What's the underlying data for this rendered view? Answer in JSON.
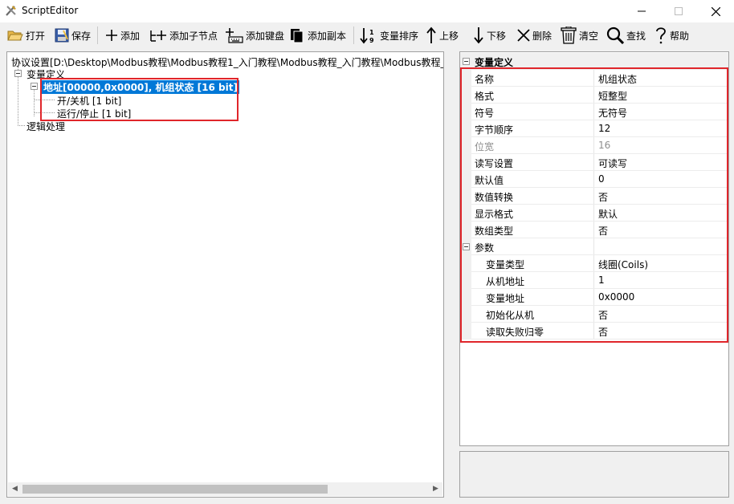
{
  "window": {
    "title": "ScriptEditor",
    "icon": "script-editor-app-icon",
    "controls": [
      "minimize-icon",
      "maximize-icon",
      "close-icon"
    ]
  },
  "toolbar": {
    "open": "打开",
    "save": "保存",
    "add": "添加",
    "add_child": "添加子节点",
    "add_key": "添加键盘",
    "add_copy": "添加副本",
    "sort_vars": "变量排序",
    "move_up": "上移",
    "move_down": "下移",
    "delete": "删除",
    "clear": "清空",
    "find": "查找",
    "help": "帮助"
  },
  "tree": {
    "root": "协议设置[D:\\Desktop\\Modbus教程\\Modbus教程1_入门教程\\Modbus教程_入门教程\\Modbus教程_入",
    "var_def": "变量定义",
    "selected_node": "地址[00000,0x0000], 机组状态 [16 bit]",
    "child1": "开/关机 [1 bit]",
    "child2": "运行/停止 [1 bit]",
    "logic": "逻辑处理"
  },
  "props": {
    "category": "变量定义",
    "rows": [
      {
        "name": "名称",
        "value": "机组状态"
      },
      {
        "name": "格式",
        "value": "短整型"
      },
      {
        "name": "符号",
        "value": "无符号"
      },
      {
        "name": "字节顺序",
        "value": "12"
      },
      {
        "name": "位宽",
        "value": "16"
      },
      {
        "name": "读写设置",
        "value": "可读写"
      },
      {
        "name": "默认值",
        "value": "0"
      },
      {
        "name": "数值转换",
        "value": "否"
      },
      {
        "name": "显示格式",
        "value": "默认"
      },
      {
        "name": "数组类型",
        "value": "否"
      }
    ],
    "params_group": "参数",
    "params": [
      {
        "name": "变量类型",
        "value": "线圈(Coils)"
      },
      {
        "name": "从机地址",
        "value": "1"
      },
      {
        "name": "变量地址",
        "value": "0x0000"
      },
      {
        "name": "初始化从机",
        "value": "否"
      },
      {
        "name": "读取失败归零",
        "value": "否"
      }
    ]
  },
  "colors": {
    "highlight_box": "#e0262b",
    "selection": "#0078d7"
  }
}
